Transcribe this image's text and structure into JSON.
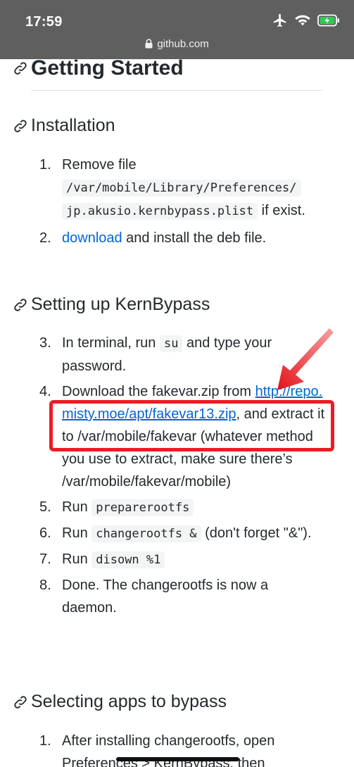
{
  "status_bar": {
    "time": "17:59",
    "icons": [
      "airplane-icon",
      "wifi-icon",
      "battery-charging-icon"
    ]
  },
  "browser": {
    "url": "github.com"
  },
  "sections": {
    "getting_started": "Getting Started",
    "installation": "Installation",
    "setting_up": "Setting up KernBypass",
    "selecting": "Selecting apps to bypass"
  },
  "installation_steps": {
    "s1": {
      "num": "1.",
      "pre": "Remove file",
      "code1": "/var/mobile/Library/Preferences/",
      "code2": "jp.akusio.kernbypass.plist",
      "post": " if exist."
    },
    "s2": {
      "num": "2.",
      "link": "download",
      "text": " and install the deb file."
    }
  },
  "setup_steps": {
    "s3": {
      "num": "3.",
      "pre": "In terminal, run ",
      "code": "su",
      "post": " and type your password."
    },
    "s4": {
      "num": "4.",
      "pre": "Download the fakevar.zip from ",
      "link": "http://repo.misty.moe/apt/fakevar13.zip",
      "post": ", and extract it to /var/mobile/fakevar (whatever method you use to extract, make sure there’s /var/mobile/fakevar/mobile)"
    },
    "s5": {
      "num": "5.",
      "pre": "Run ",
      "code": "preparerootfs"
    },
    "s6": {
      "num": "6.",
      "pre": "Run ",
      "code": "changerootfs &",
      "post": " (don't forget \"&\")."
    },
    "s7": {
      "num": "7.",
      "pre": "Run ",
      "code": "disown %1"
    },
    "s8": {
      "num": "8.",
      "text": "Done. The changerootfs is now a daemon."
    }
  },
  "selecting_steps": {
    "s1": {
      "num": "1.",
      "text": "After installing changerootfs, open Preferences > KernBypass, then"
    }
  },
  "colors": {
    "link": "#0366d6",
    "callout": "#ee1b24",
    "status_bar": "#5f5f5f"
  }
}
